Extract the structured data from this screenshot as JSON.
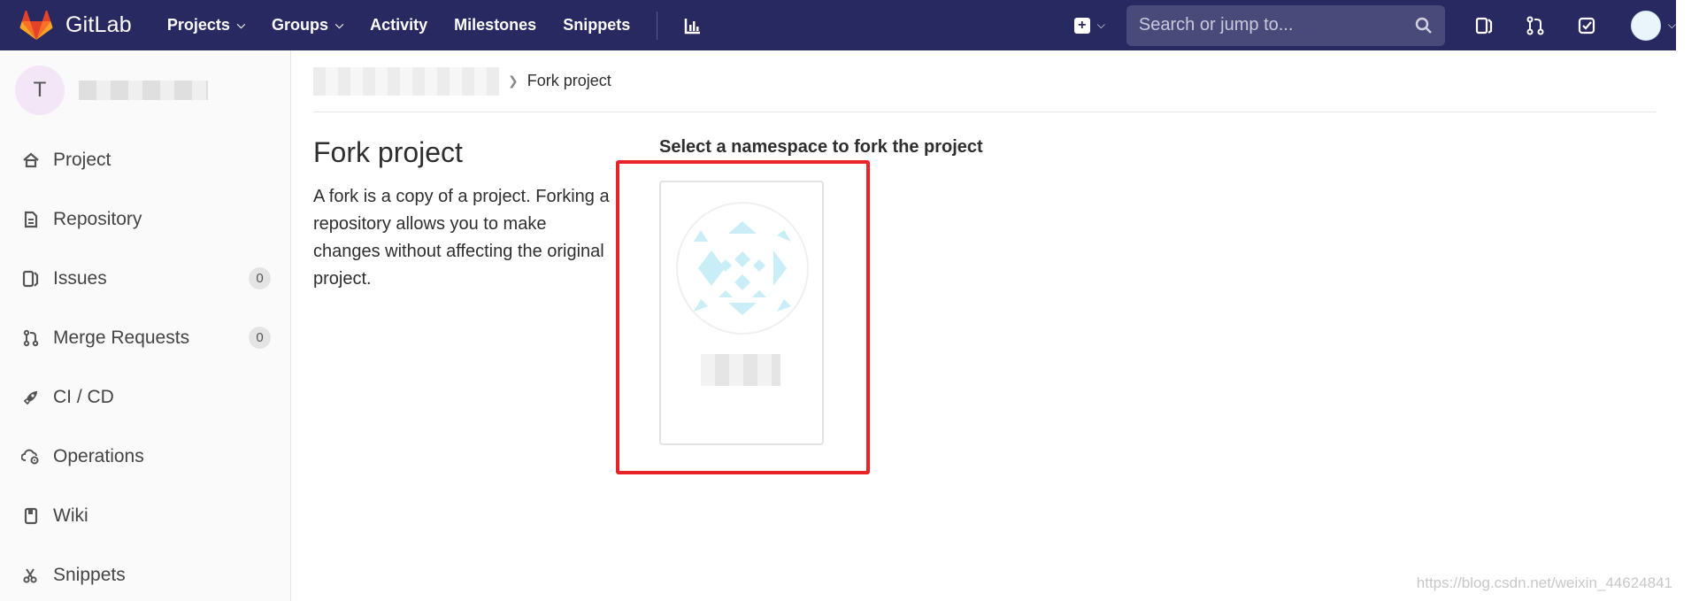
{
  "navbar": {
    "brand": "GitLab",
    "links": [
      {
        "label": "Projects",
        "has_caret": true
      },
      {
        "label": "Groups",
        "has_caret": true
      },
      {
        "label": "Activity",
        "has_caret": false
      },
      {
        "label": "Milestones",
        "has_caret": false
      },
      {
        "label": "Snippets",
        "has_caret": false
      }
    ],
    "search_placeholder": "Search or jump to...",
    "colors": {
      "background": "#292961",
      "search_bg": "#4a4a7a"
    }
  },
  "sidebar": {
    "project_initial": "T",
    "items": [
      {
        "label": "Project",
        "icon": "home-icon",
        "badge": ""
      },
      {
        "label": "Repository",
        "icon": "doc-icon",
        "badge": ""
      },
      {
        "label": "Issues",
        "icon": "issues-icon",
        "badge": "0"
      },
      {
        "label": "Merge Requests",
        "icon": "merge-request-icon",
        "badge": "0"
      },
      {
        "label": "CI / CD",
        "icon": "rocket-icon",
        "badge": ""
      },
      {
        "label": "Operations",
        "icon": "cloud-gear-icon",
        "badge": ""
      },
      {
        "label": "Wiki",
        "icon": "book-icon",
        "badge": ""
      },
      {
        "label": "Snippets",
        "icon": "scissors-icon",
        "badge": ""
      }
    ]
  },
  "breadcrumb": {
    "current": "Fork project"
  },
  "main": {
    "title": "Fork project",
    "description": "A fork is a copy of a project. Forking a repository allows you to make changes without affecting the original project.",
    "namespace_heading": "Select a namespace to fork the project",
    "highlight_color": "#e8242a"
  },
  "watermark": "https://blog.csdn.net/weixin_44624841"
}
